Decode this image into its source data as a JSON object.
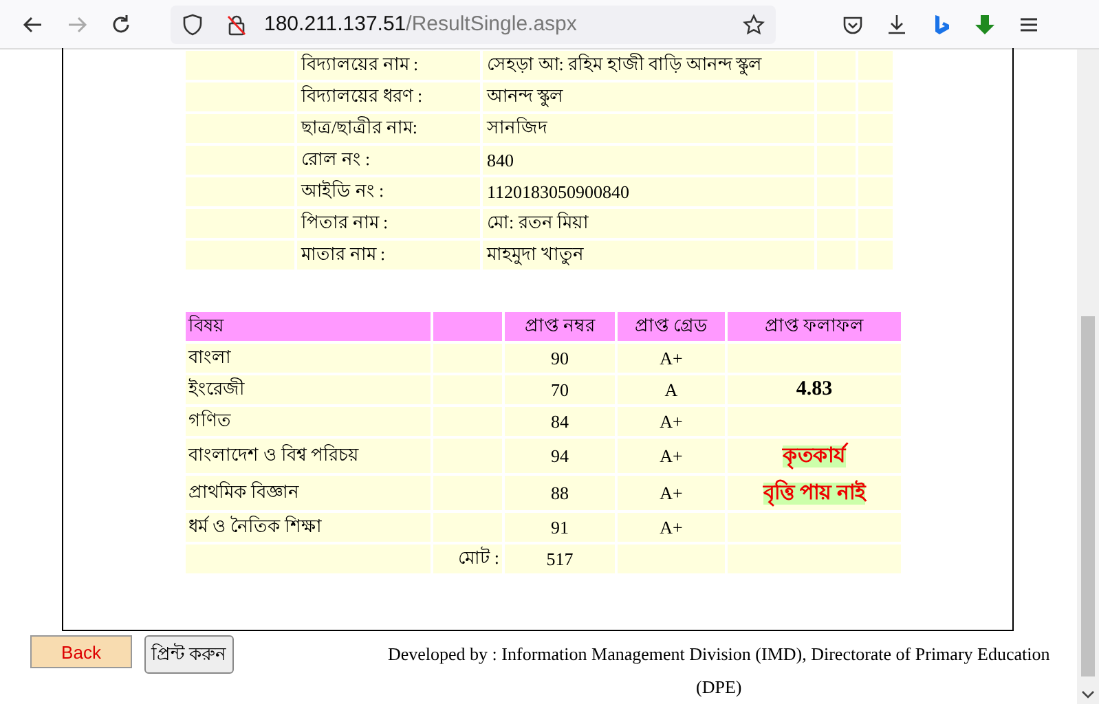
{
  "browser": {
    "url_host": "180.211.137.51",
    "url_path": "/ResultSingle.aspx"
  },
  "info": [
    {
      "label": "বিদ্যালয়ের নাম :",
      "value": "সেহড়া আ: রহিম হাজী বাড়ি আনন্দ স্কুল"
    },
    {
      "label": "বিদ্যালয়ের ধরণ :",
      "value": "আনন্দ স্কুল"
    },
    {
      "label": "ছাত্র/ছাত্রীর নাম:",
      "value": "সানজিদ"
    },
    {
      "label": "রোল নং :",
      "value": "840"
    },
    {
      "label": "আইডি নং :",
      "value": "1120183050900840"
    },
    {
      "label": "পিতার নাম :",
      "value": "মো: রতন মিয়া"
    },
    {
      "label": "মাতার নাম :",
      "value": "মাহমুদা খাতুন"
    }
  ],
  "results": {
    "columns": [
      "বিষয়",
      "প্রাপ্ত নম্বর",
      "প্রাপ্ত গ্রেড",
      "প্রাপ্ত ফলাফল"
    ],
    "rows": [
      {
        "subject": "বাংলা",
        "marks": "90",
        "grade": "A+"
      },
      {
        "subject": "ইংরেজী",
        "marks": "70",
        "grade": "A",
        "result": {
          "kind": "gpa",
          "text": "4.83"
        }
      },
      {
        "subject": "গণিত",
        "marks": "84",
        "grade": "A+"
      },
      {
        "subject": "বাংলাদেশ ও বিশ্ব পরিচয়",
        "marks": "94",
        "grade": "A+",
        "result": {
          "kind": "status",
          "text": "কৃতকার্য"
        }
      },
      {
        "subject": "প্রাথমিক বিজ্ঞান",
        "marks": "88",
        "grade": "A+",
        "result": {
          "kind": "status",
          "text": "বৃত্তি পায় নাই"
        }
      },
      {
        "subject": "ধর্ম ও নৈতিক শিক্ষা",
        "marks": "91",
        "grade": "A+"
      }
    ],
    "total_label": "মোট :",
    "total": "517"
  },
  "buttons": {
    "back": "Back",
    "print": "প্রিন্ট করুন"
  },
  "footer": "Developed by : Information Management Division (IMD), Directorate of Primary Education (DPE)"
}
